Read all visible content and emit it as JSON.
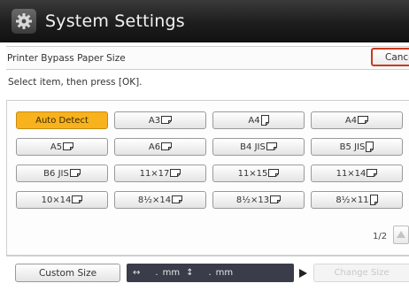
{
  "header": {
    "title": "System Settings",
    "icon": "gear-icon"
  },
  "screen": {
    "heading": "Printer Bypass Paper Size",
    "cancel_label": "Cancel",
    "instruction": "Select item, then press [OK]."
  },
  "options": [
    {
      "label": "Auto Detect",
      "orientation": "",
      "selected": true
    },
    {
      "label": "A3",
      "orientation": "landscape"
    },
    {
      "label": "A4",
      "orientation": "portrait"
    },
    {
      "label": "A4",
      "orientation": "landscape"
    },
    {
      "label": "A5",
      "orientation": "landscape"
    },
    {
      "label": "A6",
      "orientation": "landscape"
    },
    {
      "label": "B4 JIS",
      "orientation": "landscape"
    },
    {
      "label": "B5 JIS",
      "orientation": "portrait"
    },
    {
      "label": "B6 JIS",
      "orientation": "landscape"
    },
    {
      "label": "11×17",
      "orientation": "landscape"
    },
    {
      "label": "11×15",
      "orientation": "landscape"
    },
    {
      "label": "11×14",
      "orientation": "landscape"
    },
    {
      "label": "10×14",
      "orientation": "landscape"
    },
    {
      "label": "8½×14",
      "orientation": "landscape"
    },
    {
      "label": "8½×13",
      "orientation": "landscape"
    },
    {
      "label": "8½×11",
      "orientation": "portrait"
    }
  ],
  "pagination": {
    "indicator": "1/2"
  },
  "custom": {
    "button_label": "Custom Size",
    "width_arrow": "↔",
    "width_value": ".",
    "width_unit": "mm",
    "height_arrow": "↕",
    "height_value": ".",
    "height_unit": "mm",
    "change_label": "Change Size"
  },
  "colors": {
    "selected": "#f7b21e",
    "cancel_border": "#c93a1f",
    "display_bg": "#3a3c4a"
  }
}
